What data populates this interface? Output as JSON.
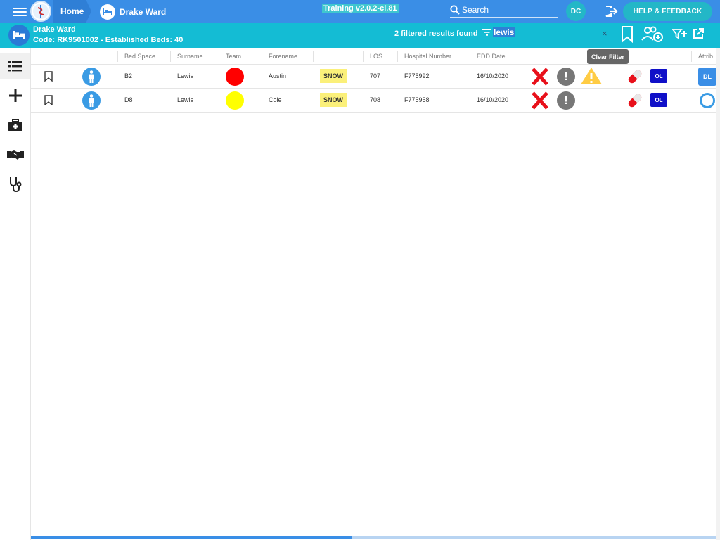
{
  "topbar": {
    "home_label": "Home",
    "ward_label": "Drake Ward",
    "version": "Training v2.0.2-ci.81",
    "search_label": "Search",
    "user_initials": "DC",
    "help_label": "HELP & FEEDBACK"
  },
  "wardbar": {
    "name": "Drake Ward",
    "code_line": "Code: RK9501002 - Established Beds: 40",
    "filtered_text": "2 filtered results found",
    "filter_value": "lewis",
    "clear_symbol": "×"
  },
  "tooltip": "Clear Filter",
  "sidenav": {
    "items": [
      "list-icon",
      "plus-icon",
      "medical-bag-icon",
      "handshake-icon",
      "stethoscope-icon"
    ]
  },
  "table": {
    "columns": [
      "Bed Space",
      "Surname",
      "Team",
      "Forename",
      "LOS",
      "Hospital Number",
      "EDD Date",
      "Attrib"
    ],
    "rows": [
      {
        "bed": "B2",
        "surname": "Lewis",
        "team_color": "#ff0000",
        "forename": "Austin",
        "consultant": "SNOW",
        "los": "707",
        "hospital_number": "F775992",
        "edd": "16/10/2020",
        "ol": "OL",
        "attr": "DL",
        "has_warning": true
      },
      {
        "bed": "D8",
        "surname": "Lewis",
        "team_color": "#ffff00",
        "forename": "Cole",
        "consultant": "SNOW",
        "los": "708",
        "hospital_number": "F775958",
        "edd": "16/10/2020",
        "ol": "OL",
        "attr": "",
        "has_warning": false
      }
    ]
  },
  "colors": {
    "primary": "#3a8ee6",
    "teal": "#14bcd4",
    "red_team": "#ff0000",
    "yellow_team": "#ffff00",
    "ol_badge": "#1010c8"
  }
}
